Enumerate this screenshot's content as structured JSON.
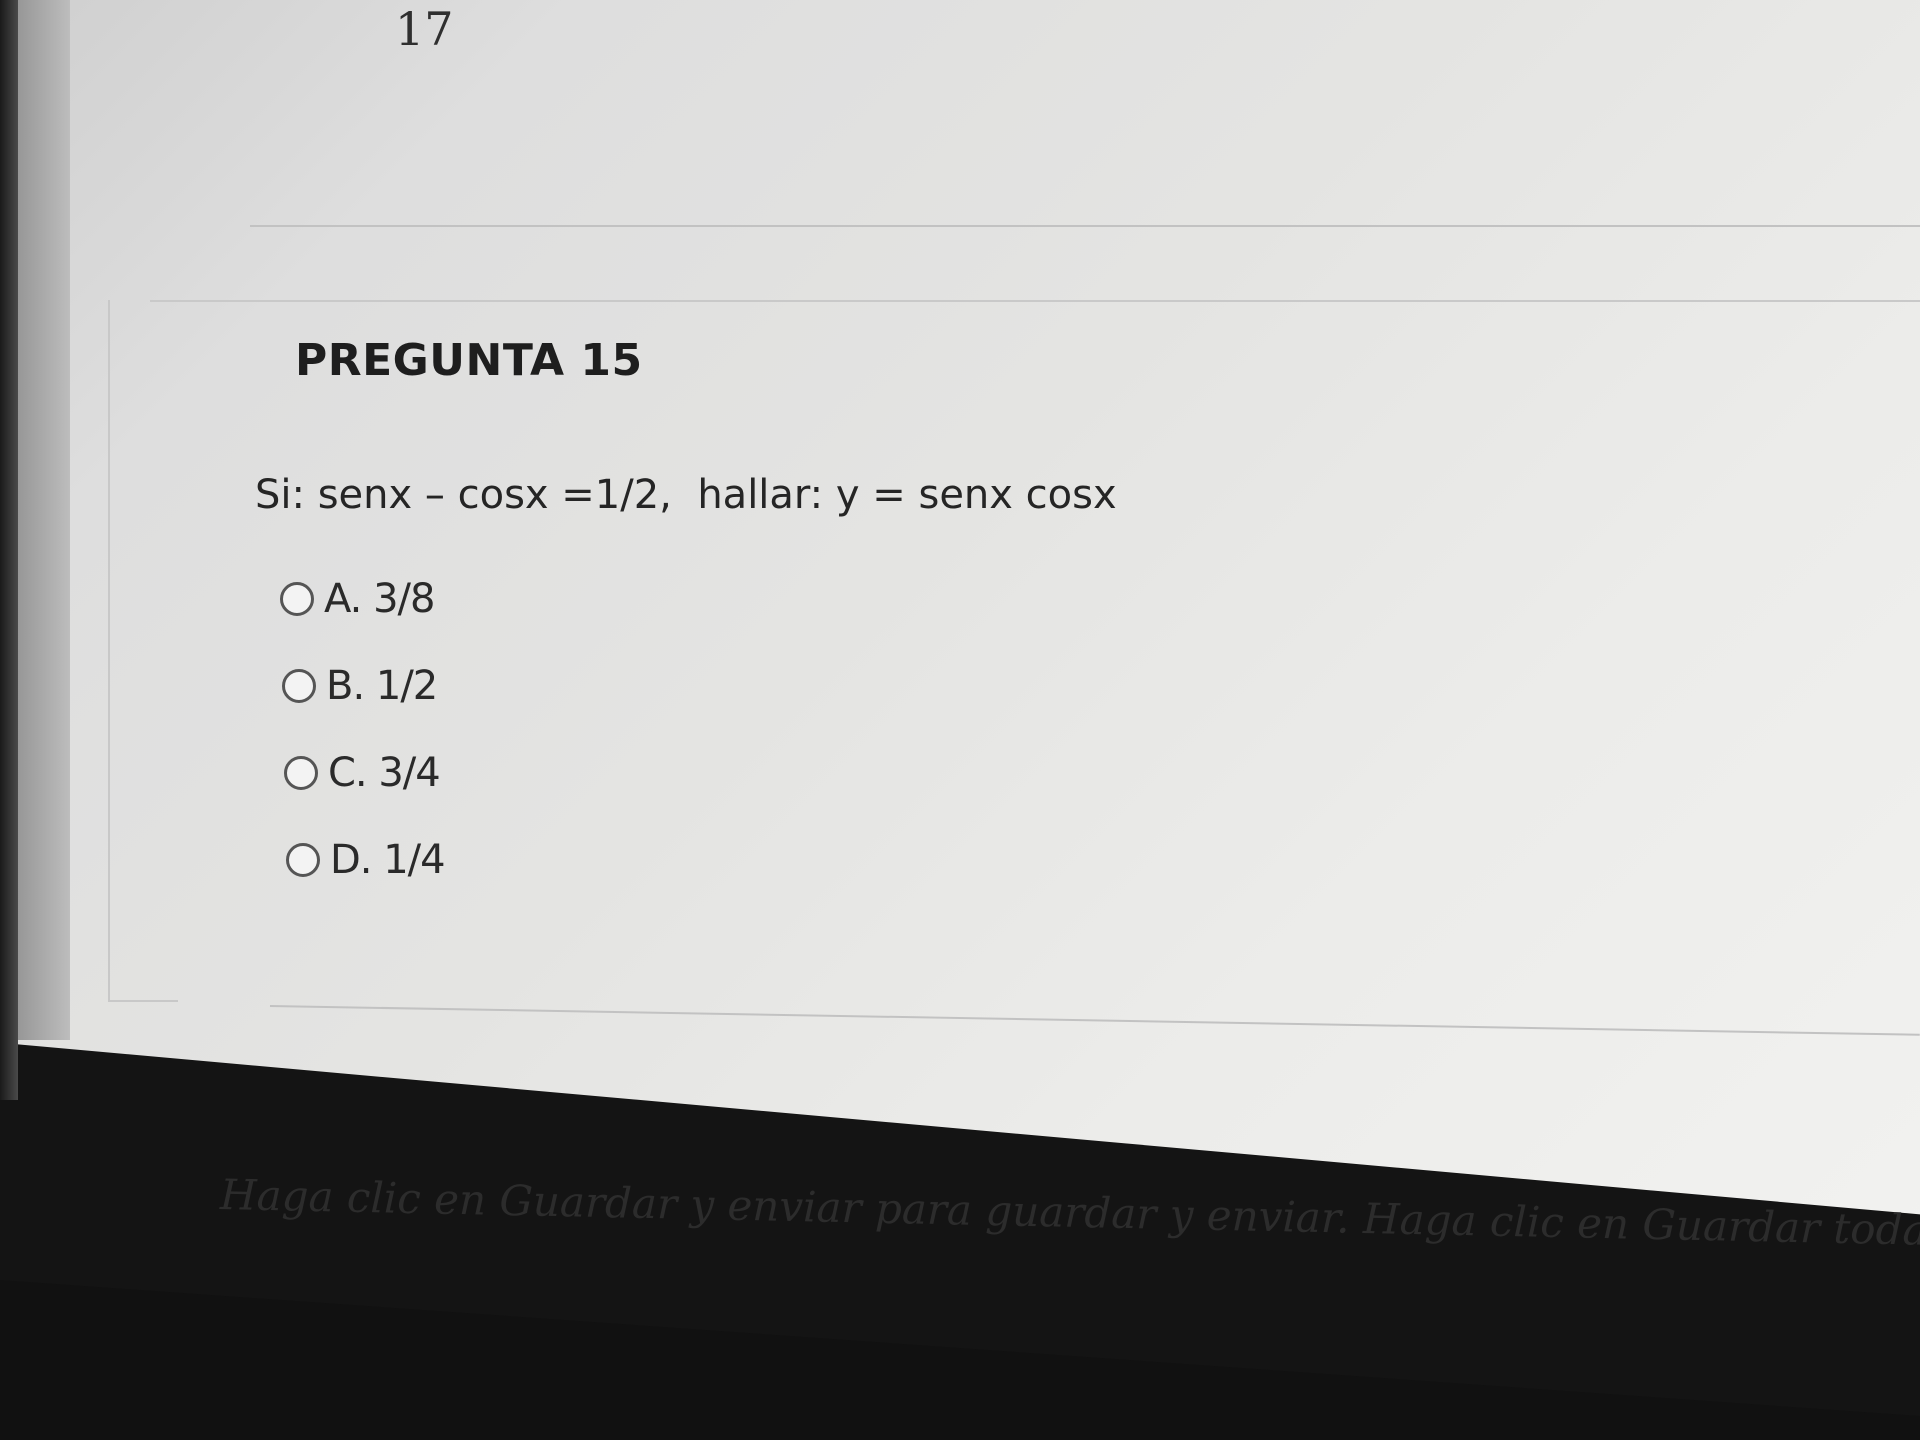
{
  "previous_question": {
    "number": "17"
  },
  "question": {
    "title": "PREGUNTA 15",
    "text": "Si: senx – cosx =1/2,  hallar: y = senx cosx",
    "options": [
      {
        "label": "A. 3/8"
      },
      {
        "label": "B. 1/2"
      },
      {
        "label": "C. 3/4"
      },
      {
        "label": "D. 1/4"
      }
    ]
  },
  "footer": {
    "instructions": "Haga clic en Guardar y enviar para guardar y enviar. Haga clic en Guardar toda"
  }
}
